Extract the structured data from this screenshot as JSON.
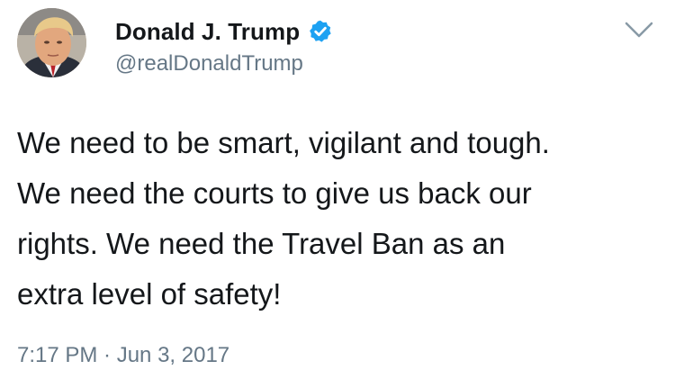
{
  "author": {
    "display_name": "Donald J. Trump",
    "handle": "@realDonaldTrump",
    "verified": true,
    "verified_icon": "verified-badge-icon",
    "avatar_icon": "profile-photo"
  },
  "menu": {
    "icon": "chevron-down-icon"
  },
  "tweet": {
    "lines": [
      "We need to be smart, vigilant and tough.",
      "We need the courts to give us back our",
      "rights. We need the Travel Ban as an",
      "extra level of safety!"
    ]
  },
  "meta": {
    "timestamp": "7:17 PM · Jun 3, 2017"
  },
  "colors": {
    "text": "#14171a",
    "secondary": "#657786",
    "verified": "#1da1f2",
    "background": "#ffffff"
  }
}
